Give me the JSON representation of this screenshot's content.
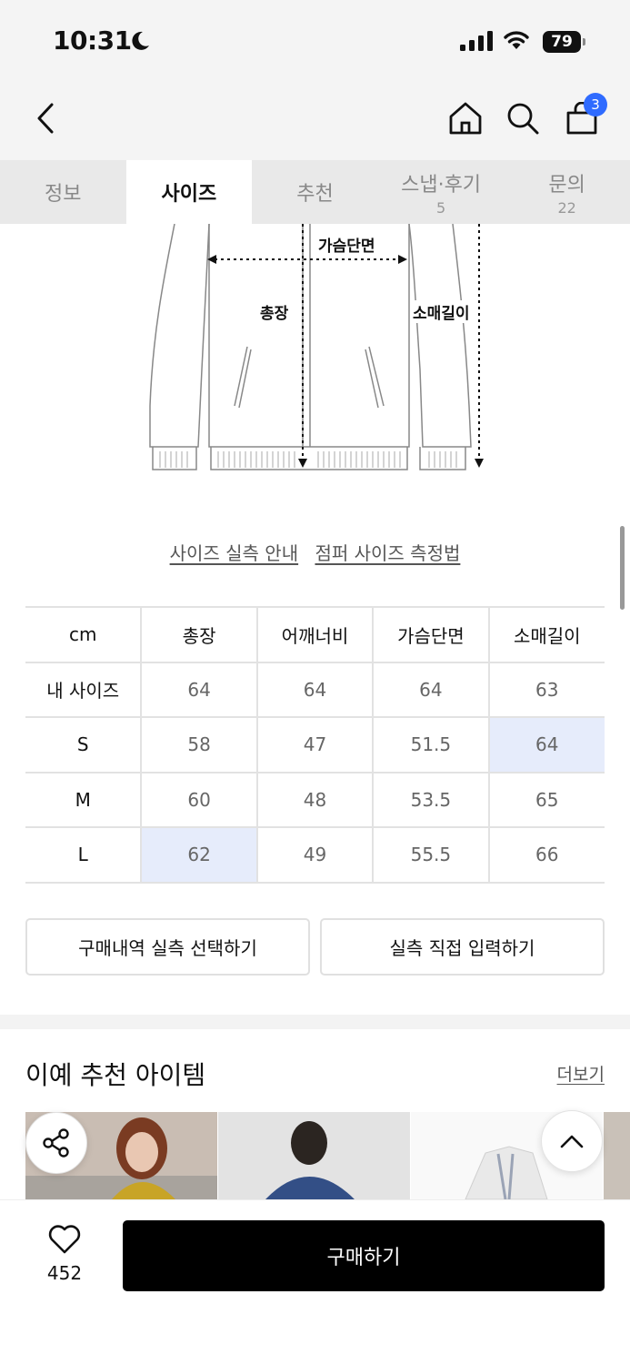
{
  "status_bar": {
    "time": "10:31",
    "battery": "79"
  },
  "header": {
    "cart_count": "3"
  },
  "tabs": [
    {
      "label": "정보",
      "sub": ""
    },
    {
      "label": "사이즈",
      "sub": ""
    },
    {
      "label": "추천",
      "sub": ""
    },
    {
      "label": "스냅·후기",
      "sub": "5"
    },
    {
      "label": "문의",
      "sub": "22"
    }
  ],
  "diagram": {
    "labels": {
      "chest": "가슴단면",
      "length": "총장",
      "sleeve": "소매길이"
    }
  },
  "size_links": {
    "guide": "사이즈 실측 안내",
    "method": "점퍼 사이즈 측정법"
  },
  "size_table": {
    "headers": [
      "cm",
      "총장",
      "어깨너비",
      "가슴단면",
      "소매길이"
    ],
    "rows": [
      [
        "내 사이즈",
        "64",
        "64",
        "64",
        "63"
      ],
      [
        "S",
        "58",
        "47",
        "51.5",
        "64"
      ],
      [
        "M",
        "60",
        "48",
        "53.5",
        "65"
      ],
      [
        "L",
        "62",
        "49",
        "55.5",
        "66"
      ]
    ]
  },
  "actions": {
    "select_history": "구매내역 실측 선택하기",
    "direct_input": "실측 직접 입력하기"
  },
  "recommend": {
    "title": "이예 추천 아이템",
    "more": "더보기"
  },
  "bottom_bar": {
    "likes": "452",
    "buy_label": "구매하기"
  },
  "colors": {
    "accent": "#2f6bff",
    "highlight": "#e6ecfb",
    "buy_button": "#000000"
  }
}
